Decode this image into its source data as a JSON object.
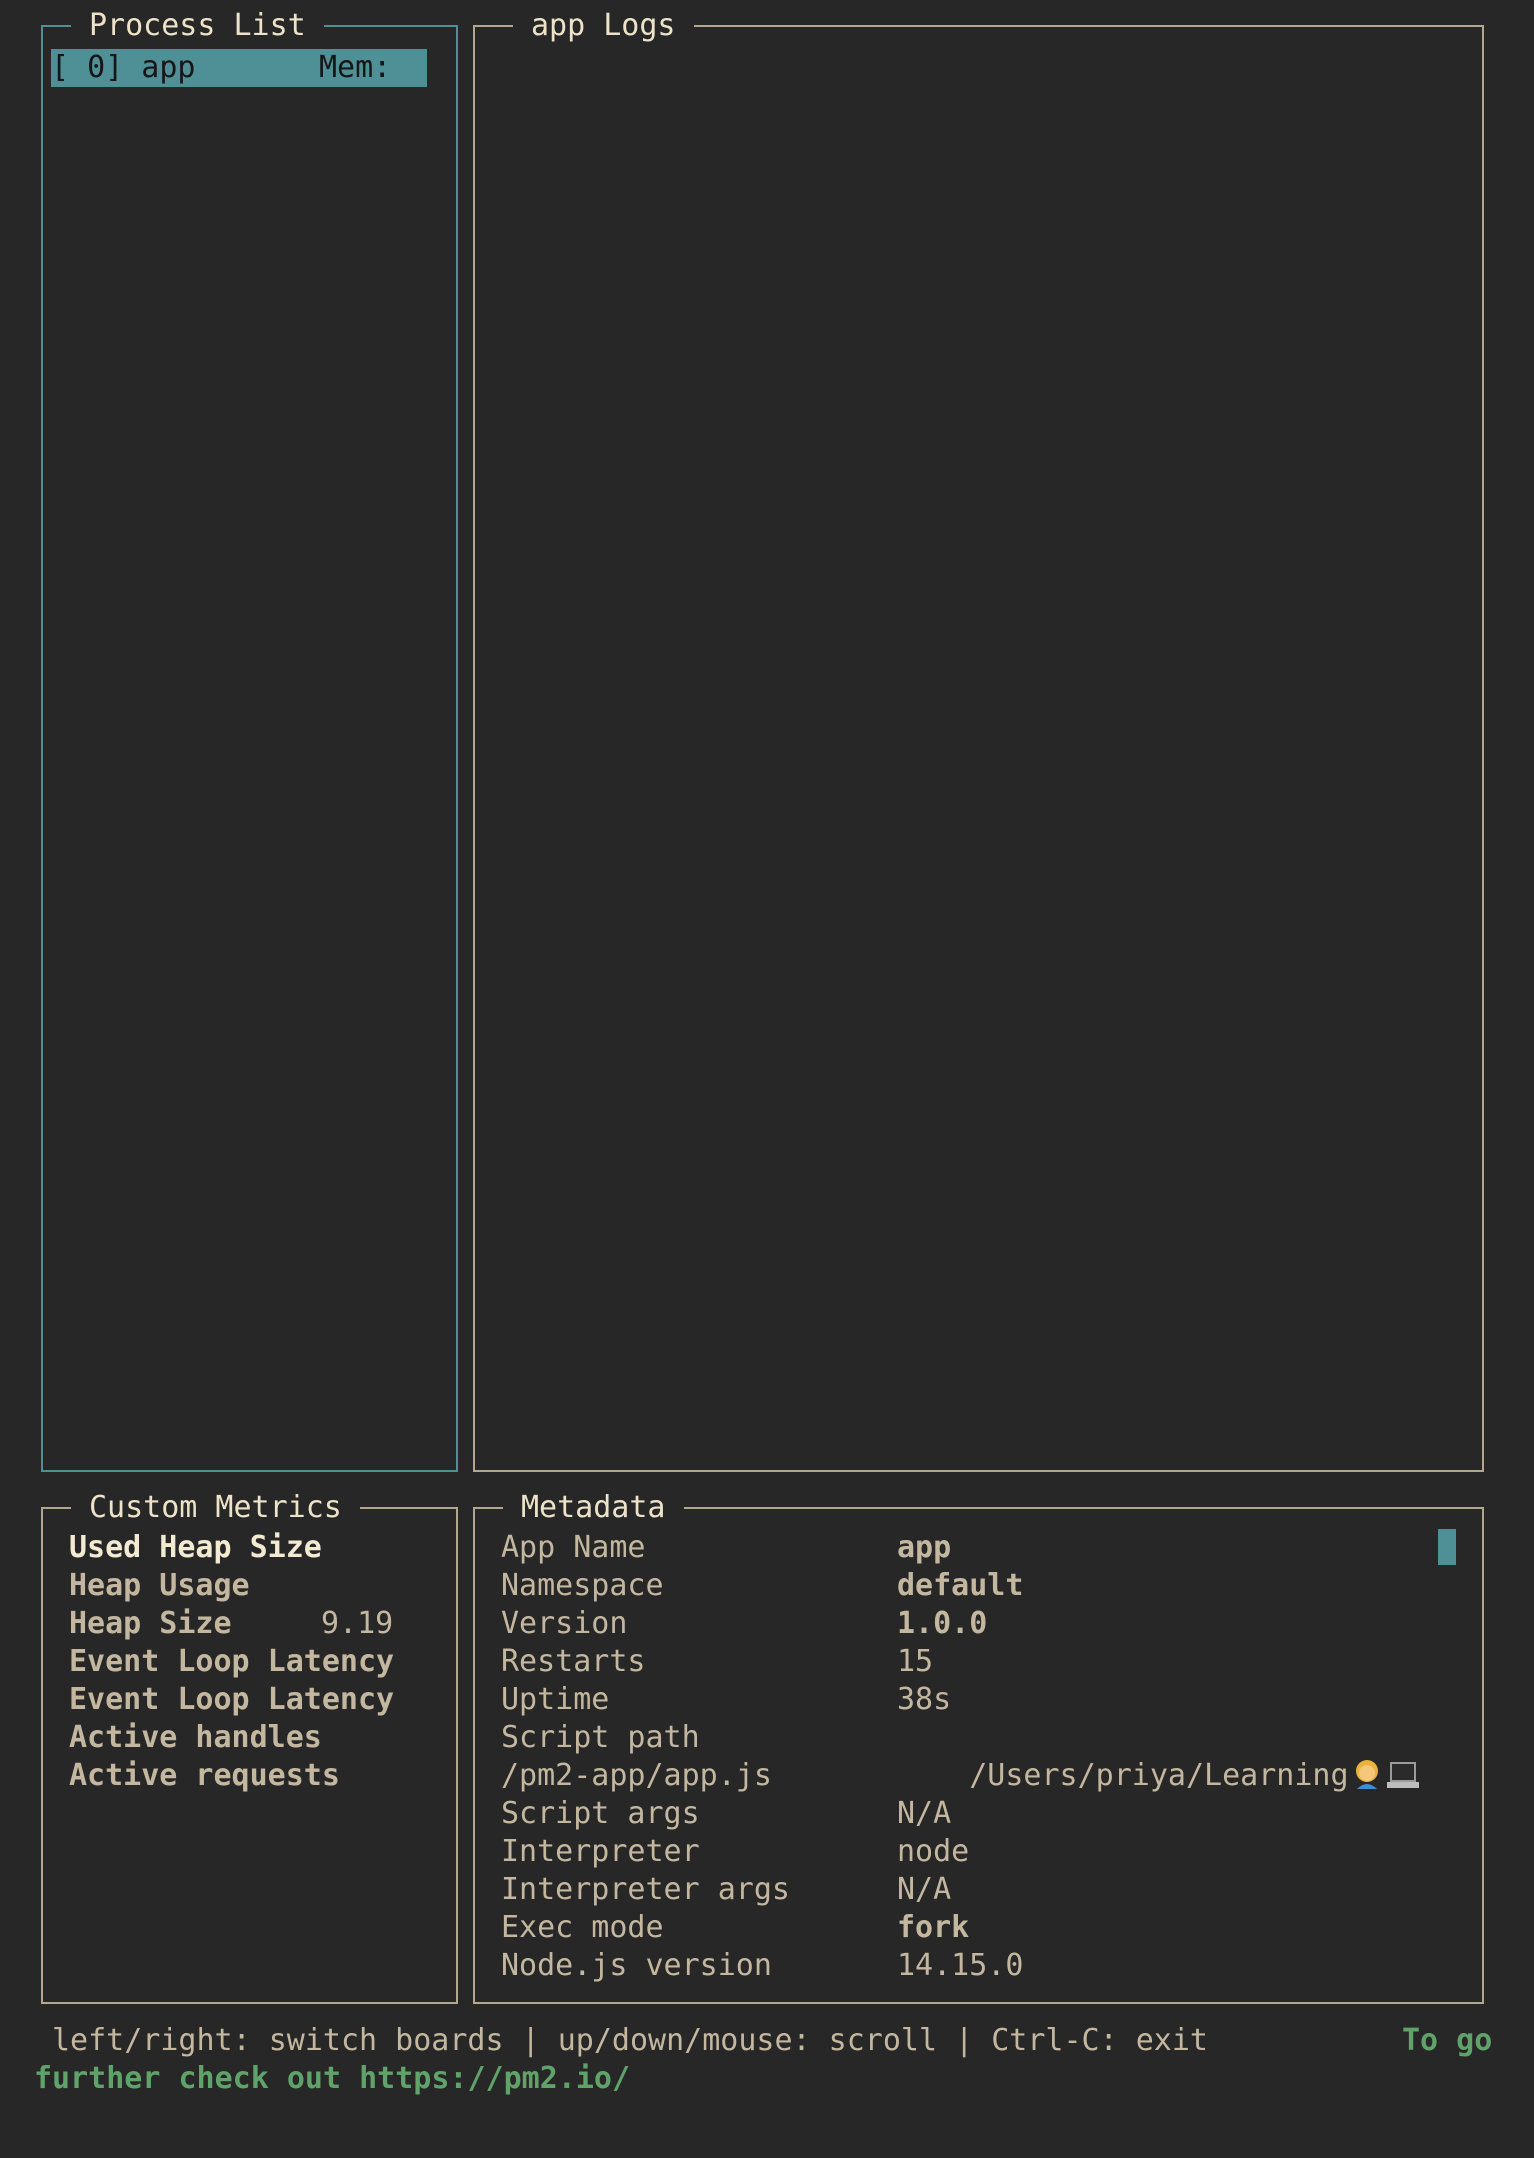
{
  "process_list": {
    "title": "Process List",
    "items": [
      {
        "label": "[ 0] app",
        "mem_label": "Mem:"
      }
    ]
  },
  "logs": {
    "title": "app Logs"
  },
  "custom_metrics": {
    "title": "Custom Metrics",
    "items": [
      {
        "name": "Used Heap Size",
        "value": ""
      },
      {
        "name": "Heap Usage",
        "value": ""
      },
      {
        "name": "Heap Size",
        "value": "9.19"
      },
      {
        "name": "Event Loop Latency",
        "value": ""
      },
      {
        "name": "Event Loop Latency",
        "value": ""
      },
      {
        "name": "Active handles",
        "value": ""
      },
      {
        "name": "Active requests",
        "value": ""
      }
    ]
  },
  "metadata": {
    "title": "Metadata",
    "rows": [
      {
        "key": "App Name",
        "value": "app"
      },
      {
        "key": "Namespace",
        "value": "default"
      },
      {
        "key": "Version",
        "value": "1.0.0"
      },
      {
        "key": "Restarts",
        "value": "15"
      },
      {
        "key": "Uptime",
        "value": "38s"
      },
      {
        "key": "Script path",
        "value": "/Users/priya/Learning"
      },
      {
        "key": "/pm2-app/app.js",
        "value": ""
      },
      {
        "key": "Script args",
        "value": "N/A"
      },
      {
        "key": "Interpreter",
        "value": "node"
      },
      {
        "key": "Interpreter args",
        "value": "N/A"
      },
      {
        "key": "Exec mode",
        "value": "fork"
      },
      {
        "key": "Node.js version",
        "value": "14.15.0"
      }
    ],
    "script_path_icons": [
      "woman-icon",
      "laptop-icon"
    ]
  },
  "footer": {
    "help": "left/right: switch boards | up/down/mouse: scroll | Ctrl-C: exit",
    "link_start": "To go",
    "link_rest": "further check out https://pm2.io/"
  },
  "colors": {
    "background": "#272727",
    "focus_border": "#4f8f96",
    "border": "#b3a78e",
    "text": "#c4b79f",
    "link": "#5fa36a"
  }
}
